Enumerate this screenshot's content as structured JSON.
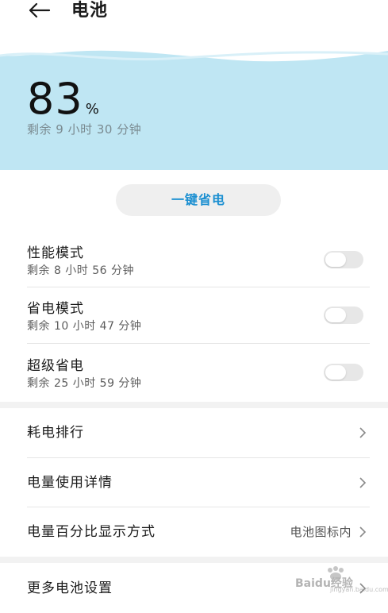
{
  "header": {
    "title": "电池"
  },
  "battery": {
    "percent": "83",
    "unit": "%",
    "remaining": "剩余 9 小时 30 分钟"
  },
  "save_button": {
    "label": "一键省电"
  },
  "modes": [
    {
      "title": "性能模式",
      "sub": "剩余 8 小时 56 分钟",
      "enabled": false
    },
    {
      "title": "省电模式",
      "sub": "剩余 10 小时 47 分钟",
      "enabled": false
    },
    {
      "title": "超级省电",
      "sub": "剩余 25 小时 59 分钟",
      "enabled": false
    }
  ],
  "nav": [
    {
      "label": "耗电排行",
      "value": ""
    },
    {
      "label": "电量使用详情",
      "value": ""
    },
    {
      "label": "电量百分比显示方式",
      "value": "电池图标内"
    },
    {
      "label": "更多电池设置",
      "value": ""
    }
  ],
  "watermark": {
    "text": "Baidu经验",
    "sub": "jingyan.baidu.com"
  },
  "colors": {
    "hero_bg": "#bfe6f3",
    "accent": "#1b8fd1",
    "toggle_off": "#e7e7e7"
  }
}
